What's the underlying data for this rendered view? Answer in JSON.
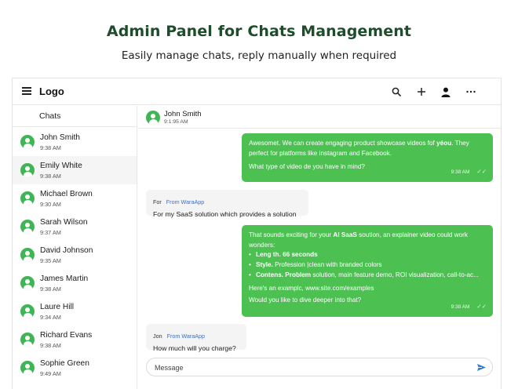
{
  "hero": {
    "title": "Admin Panel for Chats Management",
    "subtitle": "Easily manage chats, reply manually when required"
  },
  "topbar": {
    "logo": "Logo",
    "icons": [
      "menu-icon",
      "search-icon",
      "plus-icon",
      "user-icon",
      "more-icon"
    ]
  },
  "sidebar": {
    "heading": "Chats",
    "items": [
      {
        "name": "John Smith",
        "time": "9:38 AM"
      },
      {
        "name": "Emily White",
        "time": "9:38 AM"
      },
      {
        "name": "Michael Brown",
        "time": "9:30 AM"
      },
      {
        "name": "Sarah Wilson",
        "time": "9:37 AM"
      },
      {
        "name": "David Johnson",
        "time": "9:35 AM"
      },
      {
        "name": "James Martin",
        "time": "9:38 AM"
      },
      {
        "name": "Laure Hill",
        "time": "9:34 AM"
      },
      {
        "name": "Richard Evans",
        "time": "9:38 AM"
      },
      {
        "name": "Sophie Green",
        "time": "9:49 AM"
      }
    ]
  },
  "conversation": {
    "name": "John Smith",
    "time": "9:1:95 AM",
    "messages": [
      {
        "line1a": "Awesomet. We can create engaging product showcase videos fof ",
        "line1b": "yéou",
        "line1c": ". They",
        "line2": "perfect for platforms like instagram and Facebook.",
        "line3": "What type of video de you have in mind?",
        "time": "9:38 AM"
      },
      {
        "sender": "For",
        "source": "From WaraApp",
        "text": "For my SaaS solution which provides a solution"
      },
      {
        "intro_a": "That sounds exciting for your ",
        "intro_b": "AI SaaS",
        "intro_c": " soution, an explainer video could work",
        "intro2": "wonders:",
        "b1_label": "Leng th. 66 seconds",
        "b2_label": "Style.",
        "b2_text": " Profession |cIean with branded colors",
        "b3_label": "Contens. Problem",
        "b3_text": " solution, main feature demo, ROI visualization, call-to-ac...",
        "example": "Here's an examplc, www.site.com/examples",
        "closing": "Would you like to dive deeper into that?",
        "time": "9:38 AM"
      },
      {
        "sender": "Jon",
        "source": "From WaraApp",
        "text": "How much will you charge?"
      }
    ]
  },
  "composer": {
    "placeholder": "Message"
  },
  "colors": {
    "accent": "#4cc152",
    "title_green": "#1d4d2a",
    "link_blue": "#3a6fd0"
  }
}
